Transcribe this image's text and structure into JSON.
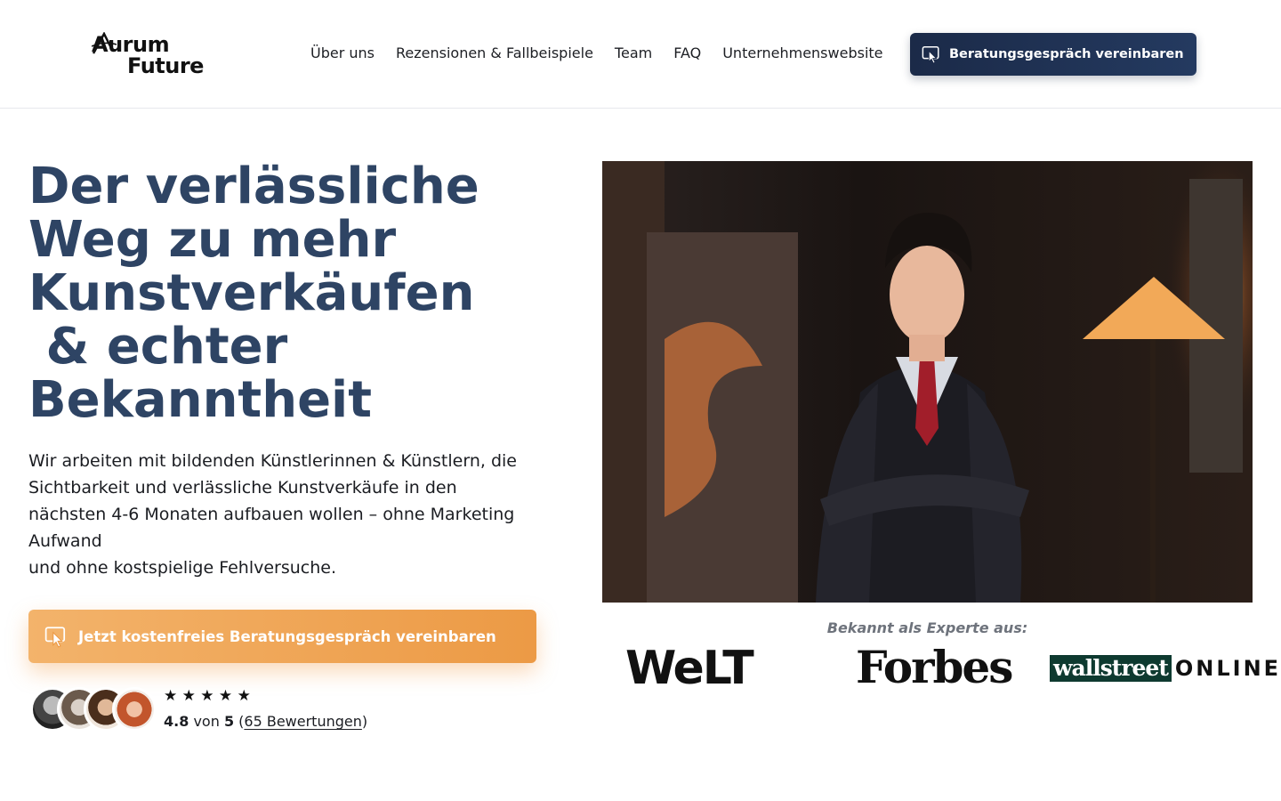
{
  "header": {
    "logo_line1": "Aurum",
    "logo_line2": "Future",
    "nav": [
      "Über uns",
      "Rezensionen & Fallbeispiele",
      "Team",
      "FAQ",
      "Unternehmenswebsite"
    ],
    "cta_label": "Beratungsgespräch vereinbaren",
    "cta_icon": "cursor-click-icon"
  },
  "hero": {
    "title_lines": [
      "Der verlässliche",
      "Weg zu mehr",
      "Kunstverkäufen",
      " & echter",
      "Bekanntheit"
    ],
    "text_lines": [
      "Wir arbeiten mit bildenden Künstlerinnen & Künstlern, die",
      "Sichtbarkeit und verlässliche Kunstverkäufe in den",
      "nächsten 4-6 Monaten aufbauen wollen – ohne Marketing",
      "Aufwand",
      "und ohne kostspielige Fehlversuche."
    ],
    "cta_label": "Jetzt kostenfreies Beratungsgespräch vereinbaren",
    "rating": {
      "stars": "★ ★ ★ ★ ★",
      "score": "4.8",
      "of": "von",
      "max": "5",
      "reviews_link": "65 Bewertungen"
    },
    "known_as": "Bekannt als Experte aus:",
    "press": [
      "WeLT",
      "Forbes",
      "wallstreet",
      "ONLINE"
    ]
  },
  "colors": {
    "title": "#2e4464",
    "header_button": "#1b2a48",
    "cta": "#ec9a45"
  }
}
